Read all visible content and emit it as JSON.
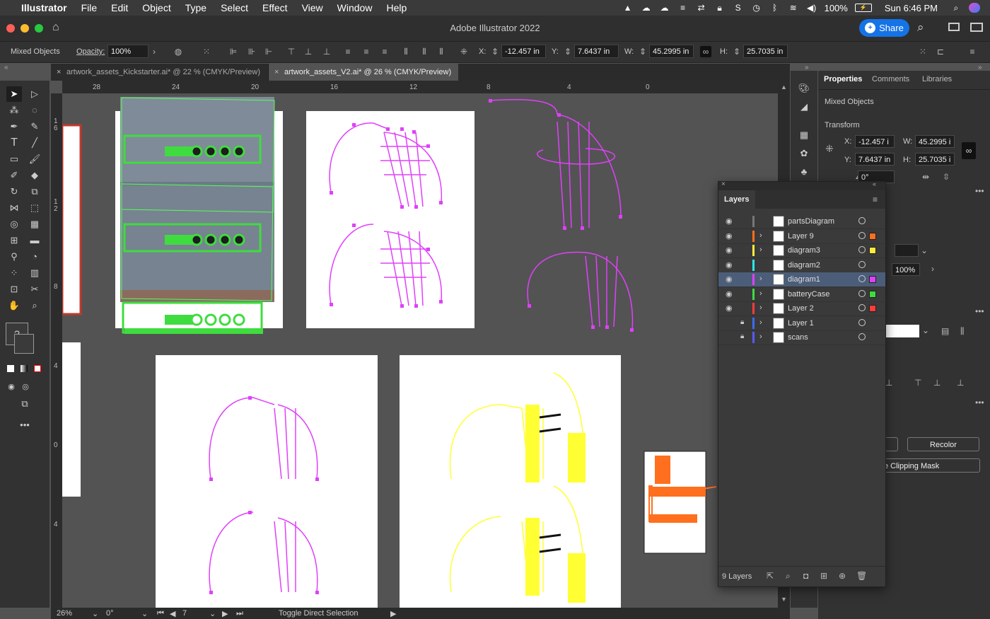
{
  "menubar": {
    "app": "Illustrator",
    "items": [
      "File",
      "Edit",
      "Object",
      "Type",
      "Select",
      "Effect",
      "View",
      "Window",
      "Help"
    ],
    "battery": "100%",
    "clock": "Sun 6:46 PM"
  },
  "titlebar": {
    "title": "Adobe Illustrator 2022",
    "share": "Share"
  },
  "control": {
    "selection": "Mixed Objects",
    "opacity_label": "Opacity:",
    "opacity": "100%",
    "x_label": "X:",
    "x": "-12.457 in",
    "y_label": "Y:",
    "y": "7.6437 in",
    "w_label": "W:",
    "w": "45.2995 in",
    "h_label": "H:",
    "h": "25.7035 in"
  },
  "tabs": [
    {
      "label": "artwork_assets_Kickstarter.ai* @ 22 % (CMYK/Preview)"
    },
    {
      "label": "artwork_assets_V2.ai* @ 26 % (CMYK/Preview)"
    }
  ],
  "ruler": {
    "h": [
      "28",
      "24",
      "20",
      "16",
      "12",
      "8",
      "4",
      "0"
    ],
    "v": [
      "1",
      "6",
      "1",
      "2",
      "8",
      "4",
      "0",
      "4"
    ]
  },
  "properties": {
    "tabs": [
      "Properties",
      "Comments",
      "Libraries"
    ],
    "selection": "Mixed Objects",
    "transform": "Transform",
    "x_label": "X:",
    "x": "-12.457 i",
    "y_label": "Y:",
    "y": "7.6437 in",
    "w_label": "W:",
    "w": "45.2995 i",
    "h_label": "H:",
    "h": "25.7035 i",
    "angle": "0°",
    "opacity": "100%",
    "recolor": "Recolor",
    "clipping": "e Clipping Mask"
  },
  "layers": {
    "title": "Layers",
    "count": "9 Layers",
    "rows": [
      {
        "name": "partsDiagram",
        "color": "#777777",
        "eye": true,
        "lock": false,
        "expand": false,
        "sel": false,
        "swatch": ""
      },
      {
        "name": "Layer 9",
        "color": "#ff6f1e",
        "eye": true,
        "lock": false,
        "expand": true,
        "sel": false,
        "swatch": "#ff6f1e"
      },
      {
        "name": "diagram3",
        "color": "#ffeb3b",
        "eye": true,
        "lock": false,
        "expand": true,
        "sel": false,
        "swatch": "#ffeb3b"
      },
      {
        "name": "diagram2",
        "color": "#2ee6e6",
        "eye": true,
        "lock": false,
        "expand": false,
        "sel": false,
        "swatch": ""
      },
      {
        "name": "diagram1",
        "color": "#e040fb",
        "eye": true,
        "lock": false,
        "expand": true,
        "sel": true,
        "swatch": "#e040fb"
      },
      {
        "name": "batteryCase",
        "color": "#3fdc3f",
        "eye": true,
        "lock": false,
        "expand": true,
        "sel": false,
        "swatch": "#3fdc3f"
      },
      {
        "name": "Layer 2",
        "color": "#ff3b3b",
        "eye": true,
        "lock": false,
        "expand": true,
        "sel": false,
        "swatch": "#ff3b3b"
      },
      {
        "name": "Layer 1",
        "color": "#3b6cff",
        "eye": false,
        "lock": true,
        "expand": true,
        "sel": false,
        "swatch": ""
      },
      {
        "name": "scans",
        "color": "#5a5aff",
        "eye": false,
        "lock": true,
        "expand": true,
        "sel": false,
        "swatch": ""
      }
    ]
  },
  "status": {
    "zoom": "26%",
    "rotate": "0°",
    "artboard": "7",
    "tool": "Toggle Direct Selection"
  }
}
